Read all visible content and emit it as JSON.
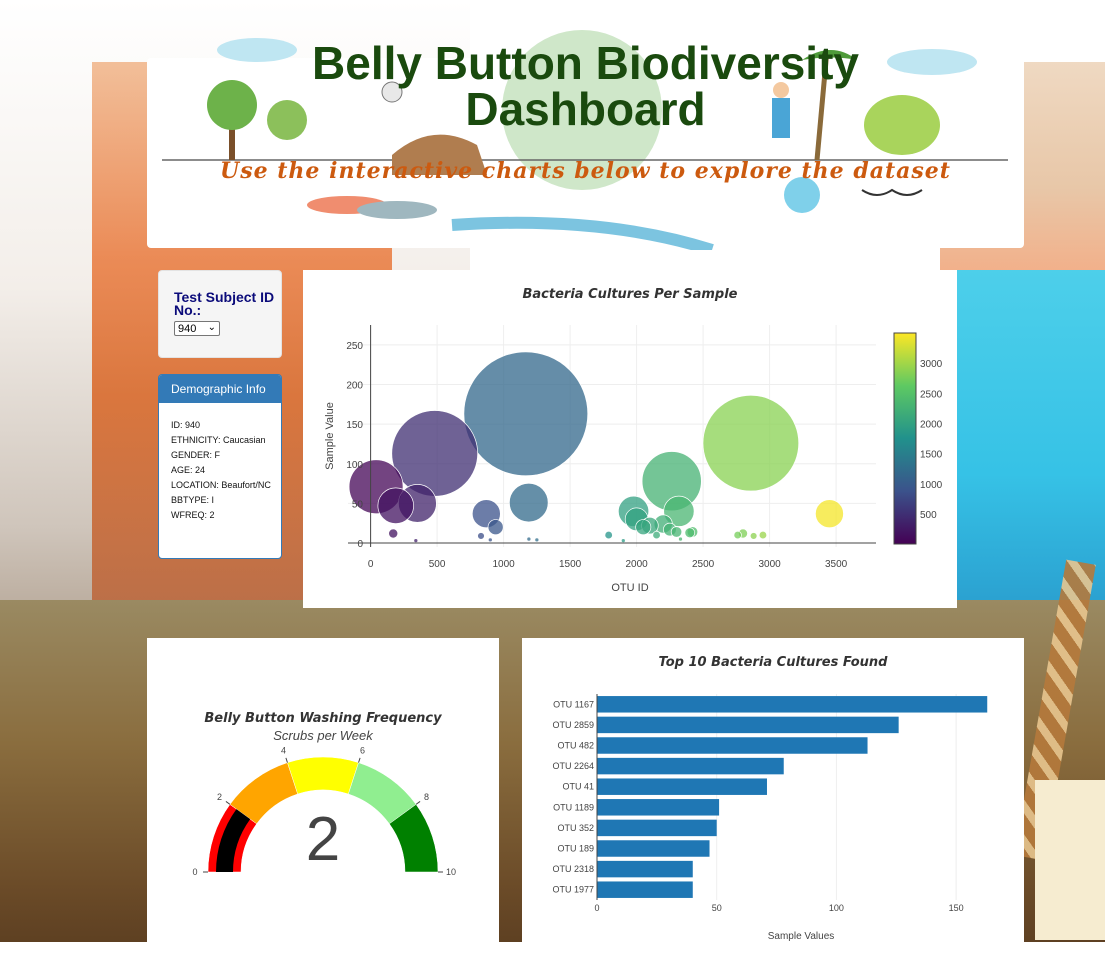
{
  "header": {
    "title_line1": "Belly Button Biodiversity",
    "title_line2": "Dashboard",
    "subtitle": "Use the interactive charts below to explore the dataset"
  },
  "selector": {
    "label": "Test Subject ID No.:",
    "selected": "940"
  },
  "demographics": {
    "heading": "Demographic Info",
    "rows": [
      "ID: 940",
      "ETHNICITY: Caucasian",
      "GENDER: F",
      "AGE: 24",
      "LOCATION: Beaufort/NC",
      "BBTYPE: I",
      "WFREQ: 2"
    ]
  },
  "colors": {
    "panel_blue": "#337ab7",
    "bar_blue": "#1f77b4",
    "title_green": "#1a4a0e",
    "subtitle_orange": "#cc5a0f"
  },
  "chart_data": [
    {
      "type": "scatter",
      "subtype": "bubble",
      "title": "Bacteria Cultures Per Sample",
      "xlabel": "OTU ID",
      "ylabel": "Sample Value",
      "xlim": [
        -170,
        3800
      ],
      "ylim": [
        -5,
        275
      ],
      "xticks": [
        0,
        500,
        1000,
        1500,
        2000,
        2500,
        3000,
        3500
      ],
      "yticks": [
        0,
        50,
        100,
        150,
        200,
        250
      ],
      "colorscale": "Viridis",
      "colorbar_ticks": [
        500,
        1000,
        1500,
        2000,
        2500,
        3000
      ],
      "colorbar_range": [
        1,
        3500
      ],
      "points": [
        {
          "x": 1167,
          "y": 163
        },
        {
          "x": 2859,
          "y": 126
        },
        {
          "x": 482,
          "y": 113
        },
        {
          "x": 2264,
          "y": 78
        },
        {
          "x": 41,
          "y": 71
        },
        {
          "x": 1189,
          "y": 51
        },
        {
          "x": 352,
          "y": 50
        },
        {
          "x": 189,
          "y": 47
        },
        {
          "x": 2318,
          "y": 40
        },
        {
          "x": 1977,
          "y": 40
        },
        {
          "x": 3450,
          "y": 37
        },
        {
          "x": 870,
          "y": 37
        },
        {
          "x": 2000,
          "y": 30
        },
        {
          "x": 2100,
          "y": 22
        },
        {
          "x": 2200,
          "y": 24
        },
        {
          "x": 2250,
          "y": 17
        },
        {
          "x": 2050,
          "y": 20
        },
        {
          "x": 940,
          "y": 20
        },
        {
          "x": 2300,
          "y": 14
        },
        {
          "x": 2400,
          "y": 13
        },
        {
          "x": 2420,
          "y": 14
        },
        {
          "x": 2800,
          "y": 12
        },
        {
          "x": 2760,
          "y": 10
        },
        {
          "x": 2950,
          "y": 10
        },
        {
          "x": 2880,
          "y": 9
        },
        {
          "x": 1790,
          "y": 10
        },
        {
          "x": 2150,
          "y": 10
        },
        {
          "x": 170,
          "y": 12
        },
        {
          "x": 830,
          "y": 9
        },
        {
          "x": 1190,
          "y": 5
        },
        {
          "x": 1250,
          "y": 4
        },
        {
          "x": 340,
          "y": 3
        },
        {
          "x": 900,
          "y": 4
        },
        {
          "x": 1900,
          "y": 3
        },
        {
          "x": 2330,
          "y": 5
        }
      ]
    },
    {
      "type": "gauge",
      "title": "Belly Button Washing Frequency",
      "subtitle": "Scrubs per Week",
      "value": 2,
      "range": [
        0,
        10
      ],
      "ticks": [
        0,
        2,
        4,
        6,
        8,
        10
      ],
      "bands": [
        {
          "from": 0,
          "to": 2,
          "color": "#ff0000"
        },
        {
          "from": 2,
          "to": 4,
          "color": "#ffa500"
        },
        {
          "from": 4,
          "to": 6,
          "color": "#ffff00"
        },
        {
          "from": 6,
          "to": 8,
          "color": "#90ee90"
        },
        {
          "from": 8,
          "to": 10,
          "color": "#008000"
        }
      ],
      "bar_color": "#000000"
    },
    {
      "type": "bar",
      "orientation": "horizontal",
      "title": "Top 10 Bacteria Cultures Found",
      "xlabel": "Sample Values",
      "xlim": [
        0,
        170
      ],
      "xticks": [
        0,
        50,
        100,
        150
      ],
      "categories": [
        "OTU 1167",
        "OTU 2859",
        "OTU 482",
        "OTU 2264",
        "OTU 41",
        "OTU 1189",
        "OTU 352",
        "OTU 189",
        "OTU 2318",
        "OTU 1977"
      ],
      "values": [
        163,
        126,
        113,
        78,
        71,
        51,
        50,
        47,
        40,
        40
      ]
    }
  ]
}
